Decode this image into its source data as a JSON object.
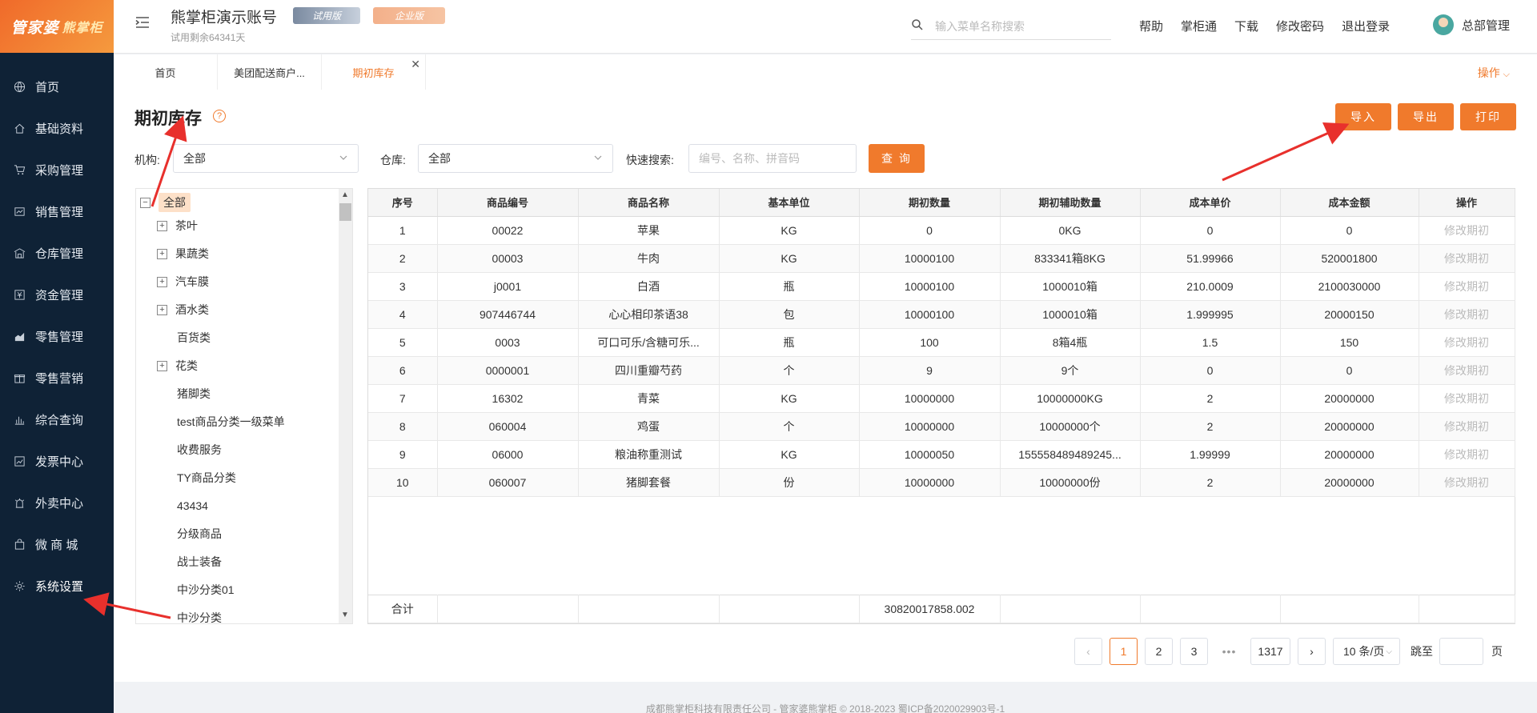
{
  "sidebar": {
    "logo_main": "管家婆",
    "logo_sub": "熊掌柜",
    "items": [
      {
        "label": "首页",
        "icon": "globe-icon"
      },
      {
        "label": "基础资料",
        "icon": "home-icon"
      },
      {
        "label": "采购管理",
        "icon": "cart-icon"
      },
      {
        "label": "销售管理",
        "icon": "sales-icon"
      },
      {
        "label": "仓库管理",
        "icon": "warehouse-icon"
      },
      {
        "label": "资金管理",
        "icon": "money-icon"
      },
      {
        "label": "零售管理",
        "icon": "retail-chart-icon"
      },
      {
        "label": "零售营销",
        "icon": "gift-icon"
      },
      {
        "label": "综合查询",
        "icon": "bar-chart-icon"
      },
      {
        "label": "发票中心",
        "icon": "invoice-chart-icon"
      },
      {
        "label": "外卖中心",
        "icon": "delivery-icon"
      },
      {
        "label": "微 商 城",
        "icon": "bag-icon"
      },
      {
        "label": "系统设置",
        "icon": "gear-icon"
      }
    ]
  },
  "header": {
    "account_name": "熊掌柜演示账号",
    "trial_remaining": "试用剩余64341天",
    "badge_trial": "试用版",
    "badge_enterprise": "企业版",
    "search_placeholder": "输入菜单名称搜索",
    "links": [
      "帮助",
      "掌柜通",
      "下载",
      "修改密码",
      "退出登录"
    ],
    "user": "总部管理"
  },
  "tabs": [
    {
      "label": "首页"
    },
    {
      "label": "美团配送商户..."
    },
    {
      "label": "期初库存"
    }
  ],
  "tabs_ops": "操作",
  "page": {
    "title": "期初库存",
    "btn_import": "导入",
    "btn_export": "导出",
    "btn_print": "打印",
    "org_label": "机构:",
    "org_value": "全部",
    "wh_label": "仓库:",
    "wh_value": "全部",
    "qs_label": "快速搜索:",
    "qs_placeholder": "编号、名称、拼音码",
    "btn_query": "查 询"
  },
  "tree": {
    "root": "全部",
    "nodes": [
      {
        "label": "茶叶",
        "expandable": true
      },
      {
        "label": "果蔬类",
        "expandable": true
      },
      {
        "label": "汽车膜",
        "expandable": true
      },
      {
        "label": "酒水类",
        "expandable": true
      },
      {
        "label": "百货类",
        "expandable": false
      },
      {
        "label": "花类",
        "expandable": true
      },
      {
        "label": "猪脚类",
        "expandable": false
      },
      {
        "label": "test商品分类一级菜单",
        "expandable": false
      },
      {
        "label": "收费服务",
        "expandable": false
      },
      {
        "label": "TY商品分类",
        "expandable": false
      },
      {
        "label": "43434",
        "expandable": false
      },
      {
        "label": "分级商品",
        "expandable": false
      },
      {
        "label": "战士装备",
        "expandable": false
      },
      {
        "label": "中沙分类01",
        "expandable": false
      },
      {
        "label": "中沙分类",
        "expandable": false
      }
    ]
  },
  "table": {
    "columns": [
      "序号",
      "商品编号",
      "商品名称",
      "基本单位",
      "期初数量",
      "期初辅助数量",
      "成本单价",
      "成本金额",
      "操作"
    ],
    "rows": [
      [
        "1",
        "00022",
        "苹果",
        "KG",
        "0",
        "0KG",
        "0",
        "0",
        "修改期初"
      ],
      [
        "2",
        "00003",
        "牛肉",
        "KG",
        "10000100",
        "833341箱8KG",
        "51.99966",
        "520001800",
        "修改期初"
      ],
      [
        "3",
        "j0001",
        "白酒",
        "瓶",
        "10000100",
        "1000010箱",
        "210.0009",
        "2100030000",
        "修改期初"
      ],
      [
        "4",
        "907446744",
        "心心相印茶语38",
        "包",
        "10000100",
        "1000010箱",
        "1.999995",
        "20000150",
        "修改期初"
      ],
      [
        "5",
        "0003",
        "可口可乐/含糖可乐...",
        "瓶",
        "100",
        "8箱4瓶",
        "1.5",
        "150",
        "修改期初"
      ],
      [
        "6",
        "0000001",
        "四川重瓣芍药",
        "个",
        "9",
        "9个",
        "0",
        "0",
        "修改期初"
      ],
      [
        "7",
        "16302",
        "青菜",
        "KG",
        "10000000",
        "10000000KG",
        "2",
        "20000000",
        "修改期初"
      ],
      [
        "8",
        "060004",
        "鸡蛋",
        "个",
        "10000000",
        "10000000个",
        "2",
        "20000000",
        "修改期初"
      ],
      [
        "9",
        "06000",
        "粮油称重测试",
        "KG",
        "10000050",
        "155558489489245...",
        "1.99999",
        "20000000",
        "修改期初"
      ],
      [
        "10",
        "060007",
        "猪脚套餐",
        "份",
        "10000000",
        "10000000份",
        "2",
        "20000000",
        "修改期初"
      ]
    ],
    "total_label": "合计",
    "total_qty": "30820017858.002"
  },
  "pager": {
    "pages": [
      "1",
      "2",
      "3"
    ],
    "dots": "•••",
    "last": "1317",
    "page_size": "10 条/页",
    "jump_label": "跳至",
    "page_suffix": "页"
  },
  "footer": "成都熊掌柜科技有限责任公司 - 管家婆熊掌柜 © 2018-2023 蜀ICP备2020029903号-1",
  "colors": {
    "accent": "#f07a2c",
    "sidebar_bg": "#0f2236",
    "arrow": "#e8302c"
  }
}
